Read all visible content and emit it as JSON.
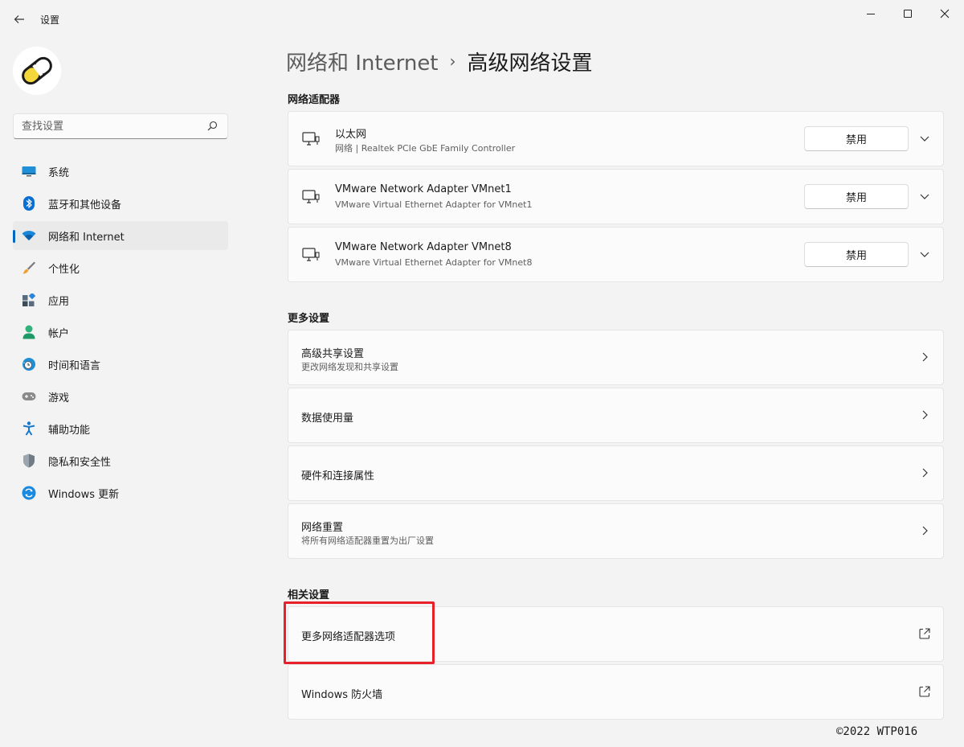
{
  "window": {
    "title": "设置"
  },
  "search": {
    "placeholder": "查找设置"
  },
  "sidebar": {
    "items": [
      {
        "label": "系统",
        "icon": "monitor-icon"
      },
      {
        "label": "蓝牙和其他设备",
        "icon": "bluetooth-icon"
      },
      {
        "label": "网络和 Internet",
        "icon": "wifi-icon",
        "active": true
      },
      {
        "label": "个性化",
        "icon": "brush-icon"
      },
      {
        "label": "应用",
        "icon": "apps-icon"
      },
      {
        "label": "帐户",
        "icon": "account-icon"
      },
      {
        "label": "时间和语言",
        "icon": "globe-clock-icon"
      },
      {
        "label": "游戏",
        "icon": "gamepad-icon"
      },
      {
        "label": "辅助功能",
        "icon": "accessibility-icon"
      },
      {
        "label": "隐私和安全性",
        "icon": "shield-icon"
      },
      {
        "label": "Windows 更新",
        "icon": "update-icon"
      }
    ]
  },
  "breadcrumb": {
    "parent": "网络和 Internet",
    "separator": "›",
    "current": "高级网络设置"
  },
  "adapters": {
    "section_title": "网络适配器",
    "items": [
      {
        "name": "以太网",
        "description": "网络 | Realtek PCIe GbE Family Controller",
        "button": "禁用"
      },
      {
        "name": "VMware Network Adapter VMnet1",
        "description": "VMware Virtual Ethernet Adapter for VMnet1",
        "button": "禁用"
      },
      {
        "name": "VMware Network Adapter VMnet8",
        "description": "VMware Virtual Ethernet Adapter for VMnet8",
        "button": "禁用"
      }
    ]
  },
  "more_settings": {
    "section_title": "更多设置",
    "items": [
      {
        "title": "高级共享设置",
        "subtitle": "更改网络发现和共享设置"
      },
      {
        "title": "数据使用量"
      },
      {
        "title": "硬件和连接属性"
      },
      {
        "title": "网络重置",
        "subtitle": "将所有网络适配器重置为出厂设置"
      }
    ]
  },
  "related": {
    "section_title": "相关设置",
    "items": [
      {
        "title": "更多网络适配器选项"
      },
      {
        "title": "Windows 防火墙"
      }
    ]
  },
  "footer": {
    "copyright": "©2022 WTP016"
  },
  "colors": {
    "accent": "#0067c0",
    "highlight": "#e8202a"
  }
}
